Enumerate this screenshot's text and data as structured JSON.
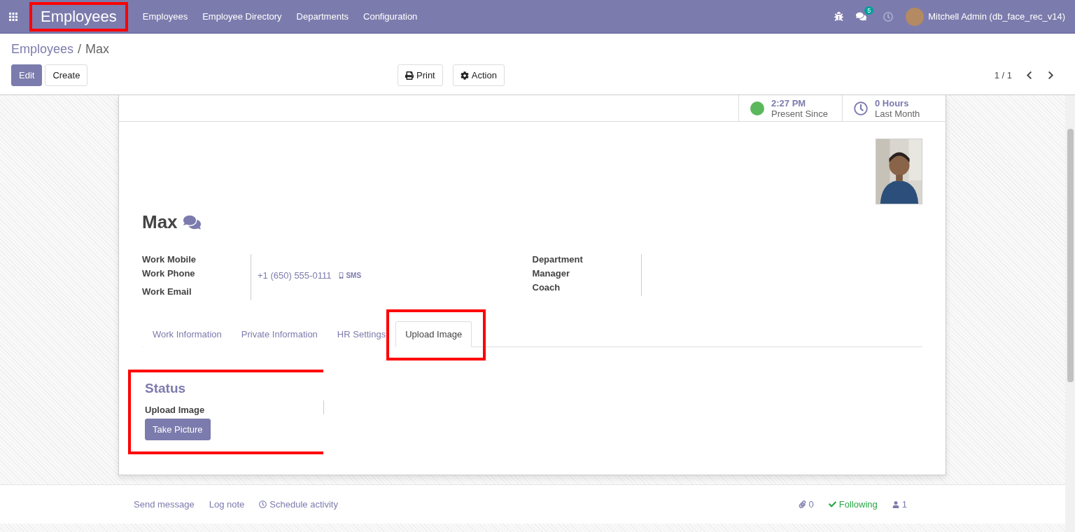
{
  "navbar": {
    "app_title": "Employees",
    "app_title_highlighted": true,
    "menu": [
      "Employees",
      "Employee Directory",
      "Departments",
      "Configuration"
    ],
    "message_count": "5",
    "user": "Mitchell Admin (db_face_rec_v14)"
  },
  "breadcrumb": {
    "parent": "Employees",
    "separator": "/",
    "current": "Max"
  },
  "buttons": {
    "edit": "Edit",
    "create": "Create",
    "print": "Print",
    "action": "Action"
  },
  "pager": "1 / 1",
  "stat_buttons": [
    {
      "kind": "presence",
      "value": "2:27 PM",
      "label": "Present Since",
      "color": "#5cb85c"
    },
    {
      "kind": "hours",
      "value": "0 Hours",
      "label": "Last Month"
    }
  ],
  "employee": {
    "name": "Max"
  },
  "fields_left": [
    {
      "label": "Work Mobile"
    },
    {
      "label": "Work Phone",
      "value": "+1 (650) 555-0111",
      "sms": "SMS"
    },
    {
      "label": "Work Email"
    }
  ],
  "fields_right": [
    {
      "label": "Department"
    },
    {
      "label": "Manager"
    },
    {
      "label": "Coach"
    }
  ],
  "tabs": [
    {
      "label": "Work Information",
      "selected": false,
      "highlighted": false
    },
    {
      "label": "Private Information",
      "selected": false,
      "highlighted": false
    },
    {
      "label": "HR Settings",
      "selected": false,
      "highlighted": false
    },
    {
      "label": "Upload Image",
      "selected": true,
      "highlighted": true
    }
  ],
  "status_section": {
    "title": "Status",
    "highlighted": true,
    "field_label": "Upload Image",
    "button": "Take Picture"
  },
  "chatter": {
    "send_message": "Send message",
    "log_note": "Log note",
    "schedule_activity": "Schedule activity",
    "attachments": "0",
    "following": "Following",
    "followers": "1"
  }
}
